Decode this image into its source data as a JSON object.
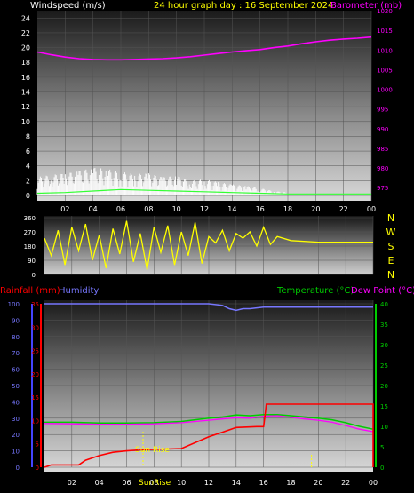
{
  "header": {
    "left_title": "Windspeed (m/s)",
    "center_title": "24 hour graph day : 16 September 2024",
    "right_title": "Barometer (mb)"
  },
  "colors": {
    "background": "#000000",
    "wind": "#ffffff",
    "wind_gust": "#ffffff",
    "wind_avg": "#33ff33",
    "barometer": "#ff00ff",
    "direction": "#ffff00",
    "rain": "#ff0000",
    "humidity": "#7777ff",
    "temperature": "#00cc00",
    "dew_point": "#ff00ff",
    "sunrise": "#ffff00",
    "axis_text_left": "#ffffff",
    "axis_text_right_baro": "#ff00ff"
  },
  "chart_data": [
    {
      "type": "line",
      "title": "Windspeed (m/s) / Barometer (mb)",
      "x_ticks": [
        "02",
        "04",
        "06",
        "08",
        "10",
        "12",
        "14",
        "16",
        "18",
        "20",
        "22",
        "00"
      ],
      "y_left": {
        "label": "Windspeed (m/s)",
        "range": [
          0,
          25
        ],
        "ticks": [
          "0",
          "2",
          "4",
          "6",
          "8",
          "10",
          "12",
          "14",
          "16",
          "18",
          "20",
          "22",
          "24"
        ]
      },
      "y_right": {
        "label": "Barometer (mb)",
        "range": [
          973,
          1020
        ],
        "ticks": [
          "975",
          "980",
          "985",
          "990",
          "995",
          "1000",
          "1005",
          "1010",
          "1015",
          "1020"
        ]
      },
      "series": [
        {
          "name": "Barometer (mb)",
          "x": [
            0,
            1,
            2,
            3,
            4,
            5,
            6,
            7,
            8,
            9,
            10,
            11,
            12,
            13,
            14,
            15,
            16,
            17,
            18,
            19,
            20,
            21,
            22,
            23,
            24
          ],
          "values": [
            1009.5,
            1008.8,
            1008.2,
            1007.8,
            1007.6,
            1007.5,
            1007.5,
            1007.6,
            1007.7,
            1007.8,
            1008.0,
            1008.3,
            1008.7,
            1009.1,
            1009.5,
            1009.8,
            1010.1,
            1010.6,
            1011.0,
            1011.6,
            1012.1,
            1012.5,
            1012.8,
            1013.0,
            1013.3
          ]
        },
        {
          "name": "Wind gust",
          "x": [
            0,
            1,
            2,
            3,
            4,
            5,
            6,
            7,
            8,
            9,
            10,
            11,
            12,
            13,
            14,
            15,
            16,
            17,
            18
          ],
          "values": [
            2.5,
            2.8,
            3.0,
            3.3,
            3.8,
            3.6,
            3.2,
            2.9,
            3.0,
            2.5,
            2.7,
            2.0,
            2.2,
            1.8,
            1.5,
            1.3,
            1.0,
            0.6,
            0.4
          ]
        },
        {
          "name": "Wind average",
          "x": [
            0,
            2,
            4,
            6,
            8,
            10,
            12,
            14,
            16,
            18,
            20,
            22,
            24
          ],
          "values": [
            0.3,
            0.4,
            0.6,
            0.8,
            0.7,
            0.6,
            0.5,
            0.4,
            0.3,
            0.2,
            0.2,
            0.2,
            0.2
          ]
        }
      ]
    },
    {
      "type": "line",
      "title": "Wind direction",
      "y_ticks": [
        "0",
        "90",
        "180",
        "270",
        "360"
      ],
      "compass_labels": [
        "N",
        "W",
        "S",
        "E",
        "N"
      ],
      "range": [
        0,
        360
      ],
      "series": [
        {
          "name": "Wind direction",
          "x": [
            0,
            0.5,
            1,
            1.5,
            2,
            2.5,
            3,
            3.5,
            4,
            4.5,
            5,
            5.5,
            6,
            6.5,
            7,
            7.5,
            8,
            8.5,
            9,
            9.5,
            10,
            10.5,
            11,
            11.5,
            12,
            12.5,
            13,
            13.5,
            14,
            14.5,
            15,
            15.5,
            16,
            16.5,
            17,
            18,
            20,
            22,
            24
          ],
          "values": [
            230,
            120,
            280,
            60,
            300,
            150,
            320,
            90,
            250,
            40,
            290,
            130,
            340,
            80,
            260,
            30,
            300,
            140,
            310,
            60,
            270,
            120,
            330,
            70,
            240,
            200,
            280,
            150,
            260,
            230,
            270,
            180,
            300,
            190,
            240,
            215,
            205,
            205,
            205
          ]
        }
      ]
    },
    {
      "type": "line",
      "title": "Rainfall / Humidity / Temperature / Dew Point",
      "x_ticks": [
        "02",
        "04",
        "06",
        "08",
        "10",
        "12",
        "14",
        "16",
        "18",
        "20",
        "22",
        "00"
      ],
      "left_labels": [
        "Rainfall (mm)",
        "Humidity"
      ],
      "right_labels": [
        "Temperature (°C)",
        "Dew Point (°C)"
      ],
      "humidity_ticks": [
        "0",
        "10",
        "20",
        "30",
        "40",
        "50",
        "60",
        "70",
        "80",
        "90",
        "100"
      ],
      "rain_ticks": [
        "0",
        "5",
        "10",
        "15",
        "20",
        "25",
        "30",
        "35"
      ],
      "temp_ticks": [
        "0",
        "5",
        "10",
        "15",
        "20",
        "25",
        "30",
        "35",
        "40"
      ],
      "annotations": [
        "Sun Rise",
        "SunRise"
      ],
      "series": [
        {
          "name": "Rainfall (mm)",
          "x": [
            0,
            0.5,
            2.5,
            3,
            4,
            5,
            6,
            7,
            8,
            10,
            12,
            13,
            14,
            15.5,
            16,
            16.2,
            24
          ],
          "values": [
            0,
            0.5,
            0.5,
            1.5,
            2.5,
            3.2,
            3.5,
            3.7,
            3.8,
            4.0,
            6.5,
            7.5,
            8.5,
            8.7,
            8.7,
            13.5,
            13.5
          ]
        },
        {
          "name": "Humidity",
          "x": [
            0,
            12,
            13,
            13.5,
            14,
            14.5,
            15,
            16,
            24
          ],
          "values": [
            100,
            100,
            99,
            97,
            96,
            97,
            97,
            98,
            98
          ]
        },
        {
          "name": "Temperature (°C)",
          "x": [
            0,
            2,
            4,
            6,
            8,
            10,
            12,
            13,
            14,
            15,
            16,
            17,
            18,
            19,
            20,
            21,
            22,
            23,
            24
          ],
          "values": [
            11.0,
            11.0,
            10.8,
            10.8,
            10.9,
            11.2,
            12.0,
            12.3,
            12.8,
            12.6,
            12.9,
            12.9,
            12.6,
            12.3,
            12.0,
            11.6,
            10.9,
            10.0,
            9.3
          ]
        },
        {
          "name": "Dew Point (°C)",
          "x": [
            0,
            2,
            4,
            6,
            8,
            10,
            12,
            13,
            14,
            15,
            16,
            17,
            18,
            19,
            20,
            21,
            22,
            23,
            24
          ],
          "values": [
            10.7,
            10.6,
            10.5,
            10.5,
            10.6,
            10.9,
            11.5,
            11.8,
            12.1,
            12.0,
            12.5,
            12.6,
            12.2,
            11.8,
            11.5,
            11.0,
            10.2,
            9.3,
            8.7
          ]
        }
      ]
    }
  ]
}
